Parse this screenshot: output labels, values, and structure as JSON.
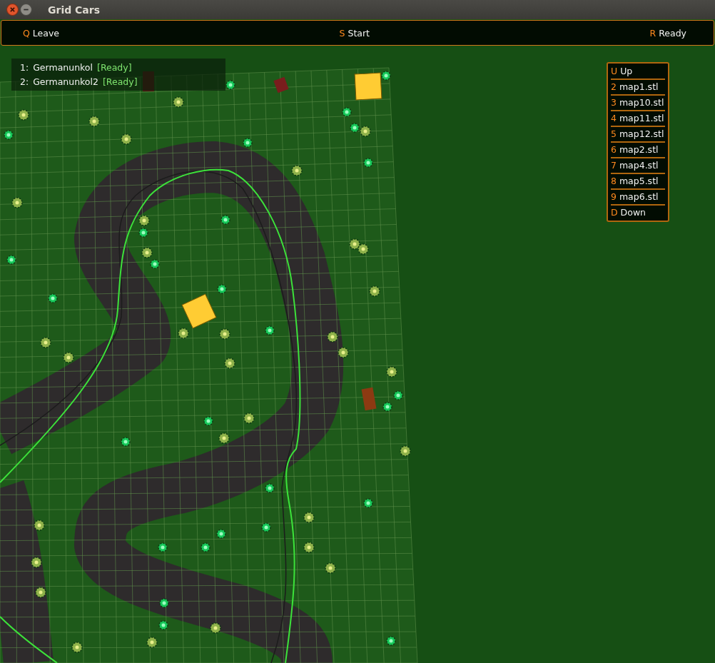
{
  "window": {
    "title": "Grid Cars"
  },
  "toolbar": [
    {
      "key": "Q",
      "label": "Leave"
    },
    {
      "key": "S",
      "label": "Start"
    },
    {
      "key": "R",
      "label": "Ready"
    }
  ],
  "players": [
    {
      "number": "1:",
      "name": "Germanunkol",
      "status": "[Ready]"
    },
    {
      "number": "2:",
      "name": "Germanunkol2",
      "status": "[Ready]"
    }
  ],
  "map_menu": [
    {
      "key": "U",
      "label": "Up"
    },
    {
      "key": "2",
      "label": "map1.stl"
    },
    {
      "key": "3",
      "label": "map10.stl"
    },
    {
      "key": "4",
      "label": "map11.stl"
    },
    {
      "key": "5",
      "label": "map12.stl"
    },
    {
      "key": "6",
      "label": "map2.stl"
    },
    {
      "key": "7",
      "label": "map4.stl"
    },
    {
      "key": "8",
      "label": "map5.stl"
    },
    {
      "key": "9",
      "label": "map6.stl"
    },
    {
      "key": "D",
      "label": "Down"
    }
  ]
}
